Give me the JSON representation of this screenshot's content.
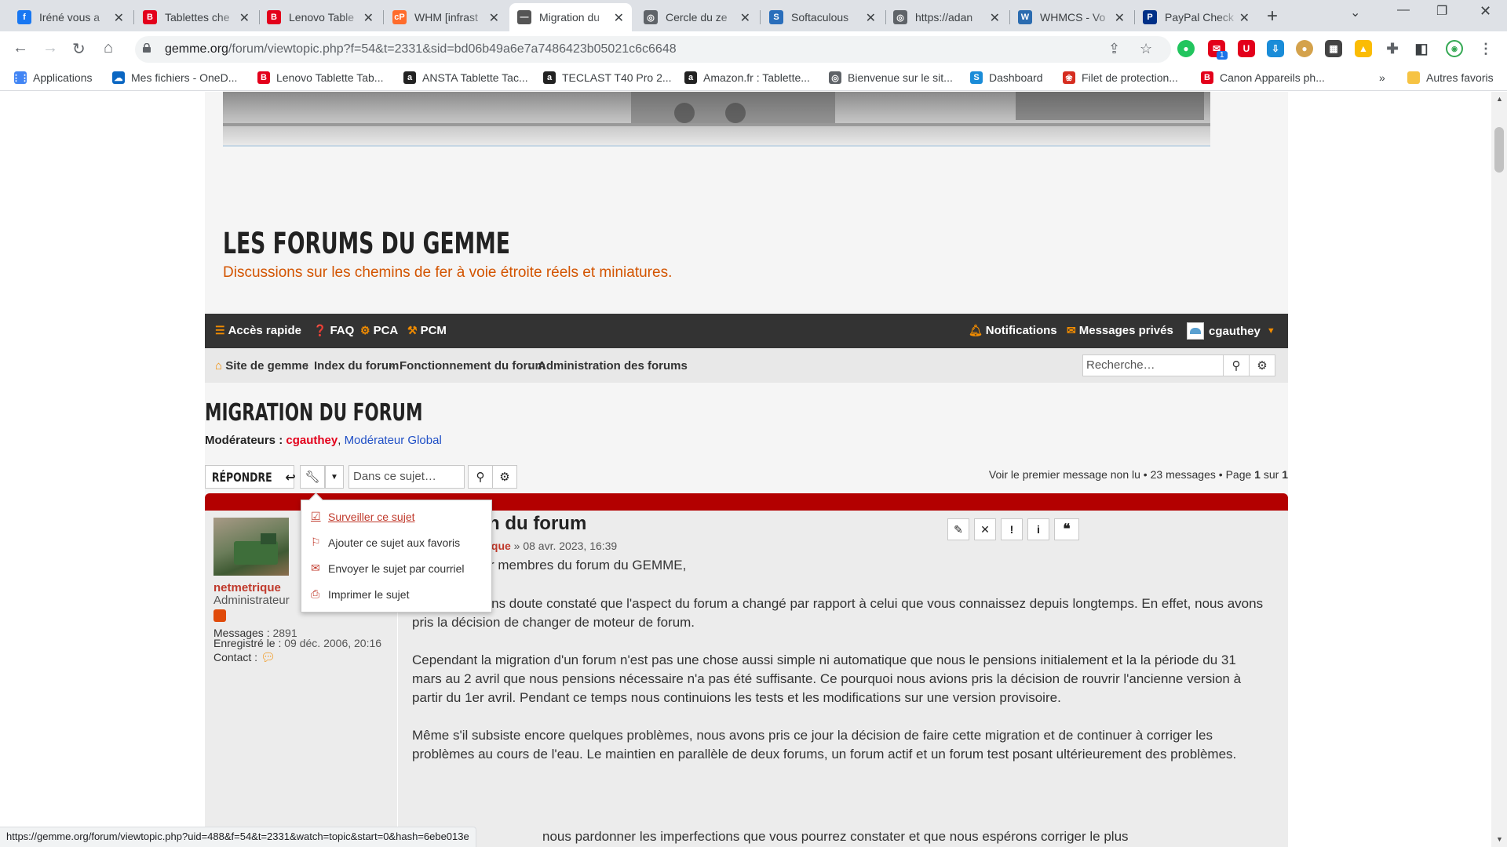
{
  "browser": {
    "tabs": [
      {
        "title": "Iréné vous a",
        "icon": "facebook-icon",
        "color": "#1877f2",
        "glyph": "f"
      },
      {
        "title": "Tablettes che",
        "icon": "b-icon",
        "color": "#e3001b",
        "glyph": "B"
      },
      {
        "title": "Lenovo Table",
        "icon": "b-icon",
        "color": "#e3001b",
        "glyph": "B"
      },
      {
        "title": "WHM [infrast",
        "icon": "cpanel-icon",
        "color": "#ff6c2c",
        "glyph": "cP"
      },
      {
        "title": "Migration du",
        "icon": "gemme-icon",
        "color": "#555555",
        "glyph": "—"
      },
      {
        "title": "Cercle du ze",
        "icon": "globe-icon",
        "color": "#5f6368",
        "glyph": "◎"
      },
      {
        "title": "Softaculous",
        "icon": "softaculous-icon",
        "color": "#2a6ebb",
        "glyph": "S"
      },
      {
        "title": "https://adan",
        "icon": "globe-icon",
        "color": "#5f6368",
        "glyph": "◎"
      },
      {
        "title": "WHMCS - Vo",
        "icon": "whmcs-icon",
        "color": "#2b6cb0",
        "glyph": "W"
      },
      {
        "title": "PayPal Check",
        "icon": "paypal-icon",
        "color": "#003087",
        "glyph": "P"
      }
    ],
    "active_tab": 4,
    "url_host": "gemme.org",
    "url_path": "/forum/viewtopic.php?f=54&t=2331&sid=bd06b49a6e7a7486423b05021c6c6648",
    "extension_badge": "1",
    "bookmarks": [
      {
        "label": "Applications",
        "icon": "apps-grid-icon",
        "color": "#4285f4",
        "glyph": "⋮⋮"
      },
      {
        "label": "Mes fichiers - OneD...",
        "icon": "onedrive-icon",
        "color": "#0a66c2",
        "glyph": "☁"
      },
      {
        "label": "Lenovo Tablette Tab...",
        "icon": "b-icon",
        "color": "#e3001b",
        "glyph": "B"
      },
      {
        "label": "ANSTA Tablette Tac...",
        "icon": "amazon-icon",
        "color": "#222222",
        "glyph": "a"
      },
      {
        "label": "TECLAST T40 Pro 2...",
        "icon": "amazon-icon",
        "color": "#222222",
        "glyph": "a"
      },
      {
        "label": "Amazon.fr : Tablette...",
        "icon": "amazon-icon",
        "color": "#222222",
        "glyph": "a"
      },
      {
        "label": "Bienvenue sur le sit...",
        "icon": "globe-icon",
        "color": "#5f6368",
        "glyph": "◎"
      },
      {
        "label": "Dashboard",
        "icon": "s-icon",
        "color": "#1a8cd8",
        "glyph": "S"
      },
      {
        "label": "Filet de protection...",
        "icon": "paw-icon",
        "color": "#d62d20",
        "glyph": "❀"
      },
      {
        "label": "Canon Appareils ph...",
        "icon": "b-icon",
        "color": "#e3001b",
        "glyph": "B"
      }
    ],
    "other_bookmarks": "Autres favoris",
    "status_url": "https://gemme.org/forum/viewtopic.php?uid=488&f=54&t=2331&watch=topic&start=0&hash=6ebe013e"
  },
  "site": {
    "title": "LES FORUMS DU GEMME",
    "description": "Discussions sur les chemins de fer à voie étroite réels et miniatures."
  },
  "navbar": {
    "quick": "Accès rapide",
    "faq": "FAQ",
    "pca": "PCA",
    "pcm": "PCM",
    "notifications": "Notifications",
    "messages": "Messages privés",
    "user": "cgauthey"
  },
  "breadcrumb": {
    "items": [
      "Site de gemme",
      "Index du forum",
      "Fonctionnement du forum",
      "Administration des forums"
    ]
  },
  "search": {
    "placeholder": "Recherche…"
  },
  "topic": {
    "title": "MIGRATION DU FORUM",
    "moderators_label": "Modérateurs :",
    "moderator1": "cgauthey",
    "moderator2": "Modérateur Global",
    "reply_label": "RÉPONDRE",
    "search_placeholder": "Dans ce sujet…",
    "first_unread": "Voir le premier message non lu",
    "count": "23 messages",
    "page_label": "Page",
    "page_current": "1",
    "page_sep": "sur",
    "page_total": "1"
  },
  "dropdown": {
    "items": [
      {
        "label": "Surveiller ce sujet",
        "icon": "checkbox-icon"
      },
      {
        "label": "Ajouter ce sujet aux favoris",
        "icon": "bookmark-icon"
      },
      {
        "label": "Envoyer le sujet par courriel",
        "icon": "envelope-icon"
      },
      {
        "label": "Imprimer le sujet",
        "icon": "print-icon"
      }
    ]
  },
  "post": {
    "title_visible": "n du forum",
    "author_visible": "ique",
    "date": "» 08 avr. 2023, 16:39",
    "greeting_visible": "r membres du forum du GEMME,",
    "paragraphs": [
      "Vous avez sans doute constaté que l'aspect du forum a changé par rapport à celui que vous connaissez depuis longtemps. En effet, nous avons pris la décision de changer de moteur de forum.",
      "Cependant la migration d'un forum n'est pas une chose aussi simple ni automatique que nous le pensions initialement et la la période du 31 mars au 2 avril que nous pensions nécessaire n'a pas été suffisante. Ce pourquoi nous avions pris la décision de rouvrir l'ancienne version à partir du 1er avril. Pendant ce temps nous continuions les tests et les modifications sur une version provisoire.",
      "Même s'il subsiste encore quelques problèmes, nous avons pris ce jour la décision de faire cette migration et de continuer à corriger les problèmes au cours de l'eau. Le maintien en parallèle de deux forums, un forum actif et un forum test posant ultérieurement des problèmes."
    ],
    "last_line_visible": "nous pardonner les imperfections que vous pourrez constater et que nous espérons corriger le plus"
  },
  "profile": {
    "username": "netmetrique",
    "rank": "Administrateur",
    "messages_label": "Messages :",
    "messages_value": "2891",
    "registered_label": "Enregistré le :",
    "registered_value": "09 déc. 2006, 20:16",
    "contact_label": "Contact :"
  }
}
